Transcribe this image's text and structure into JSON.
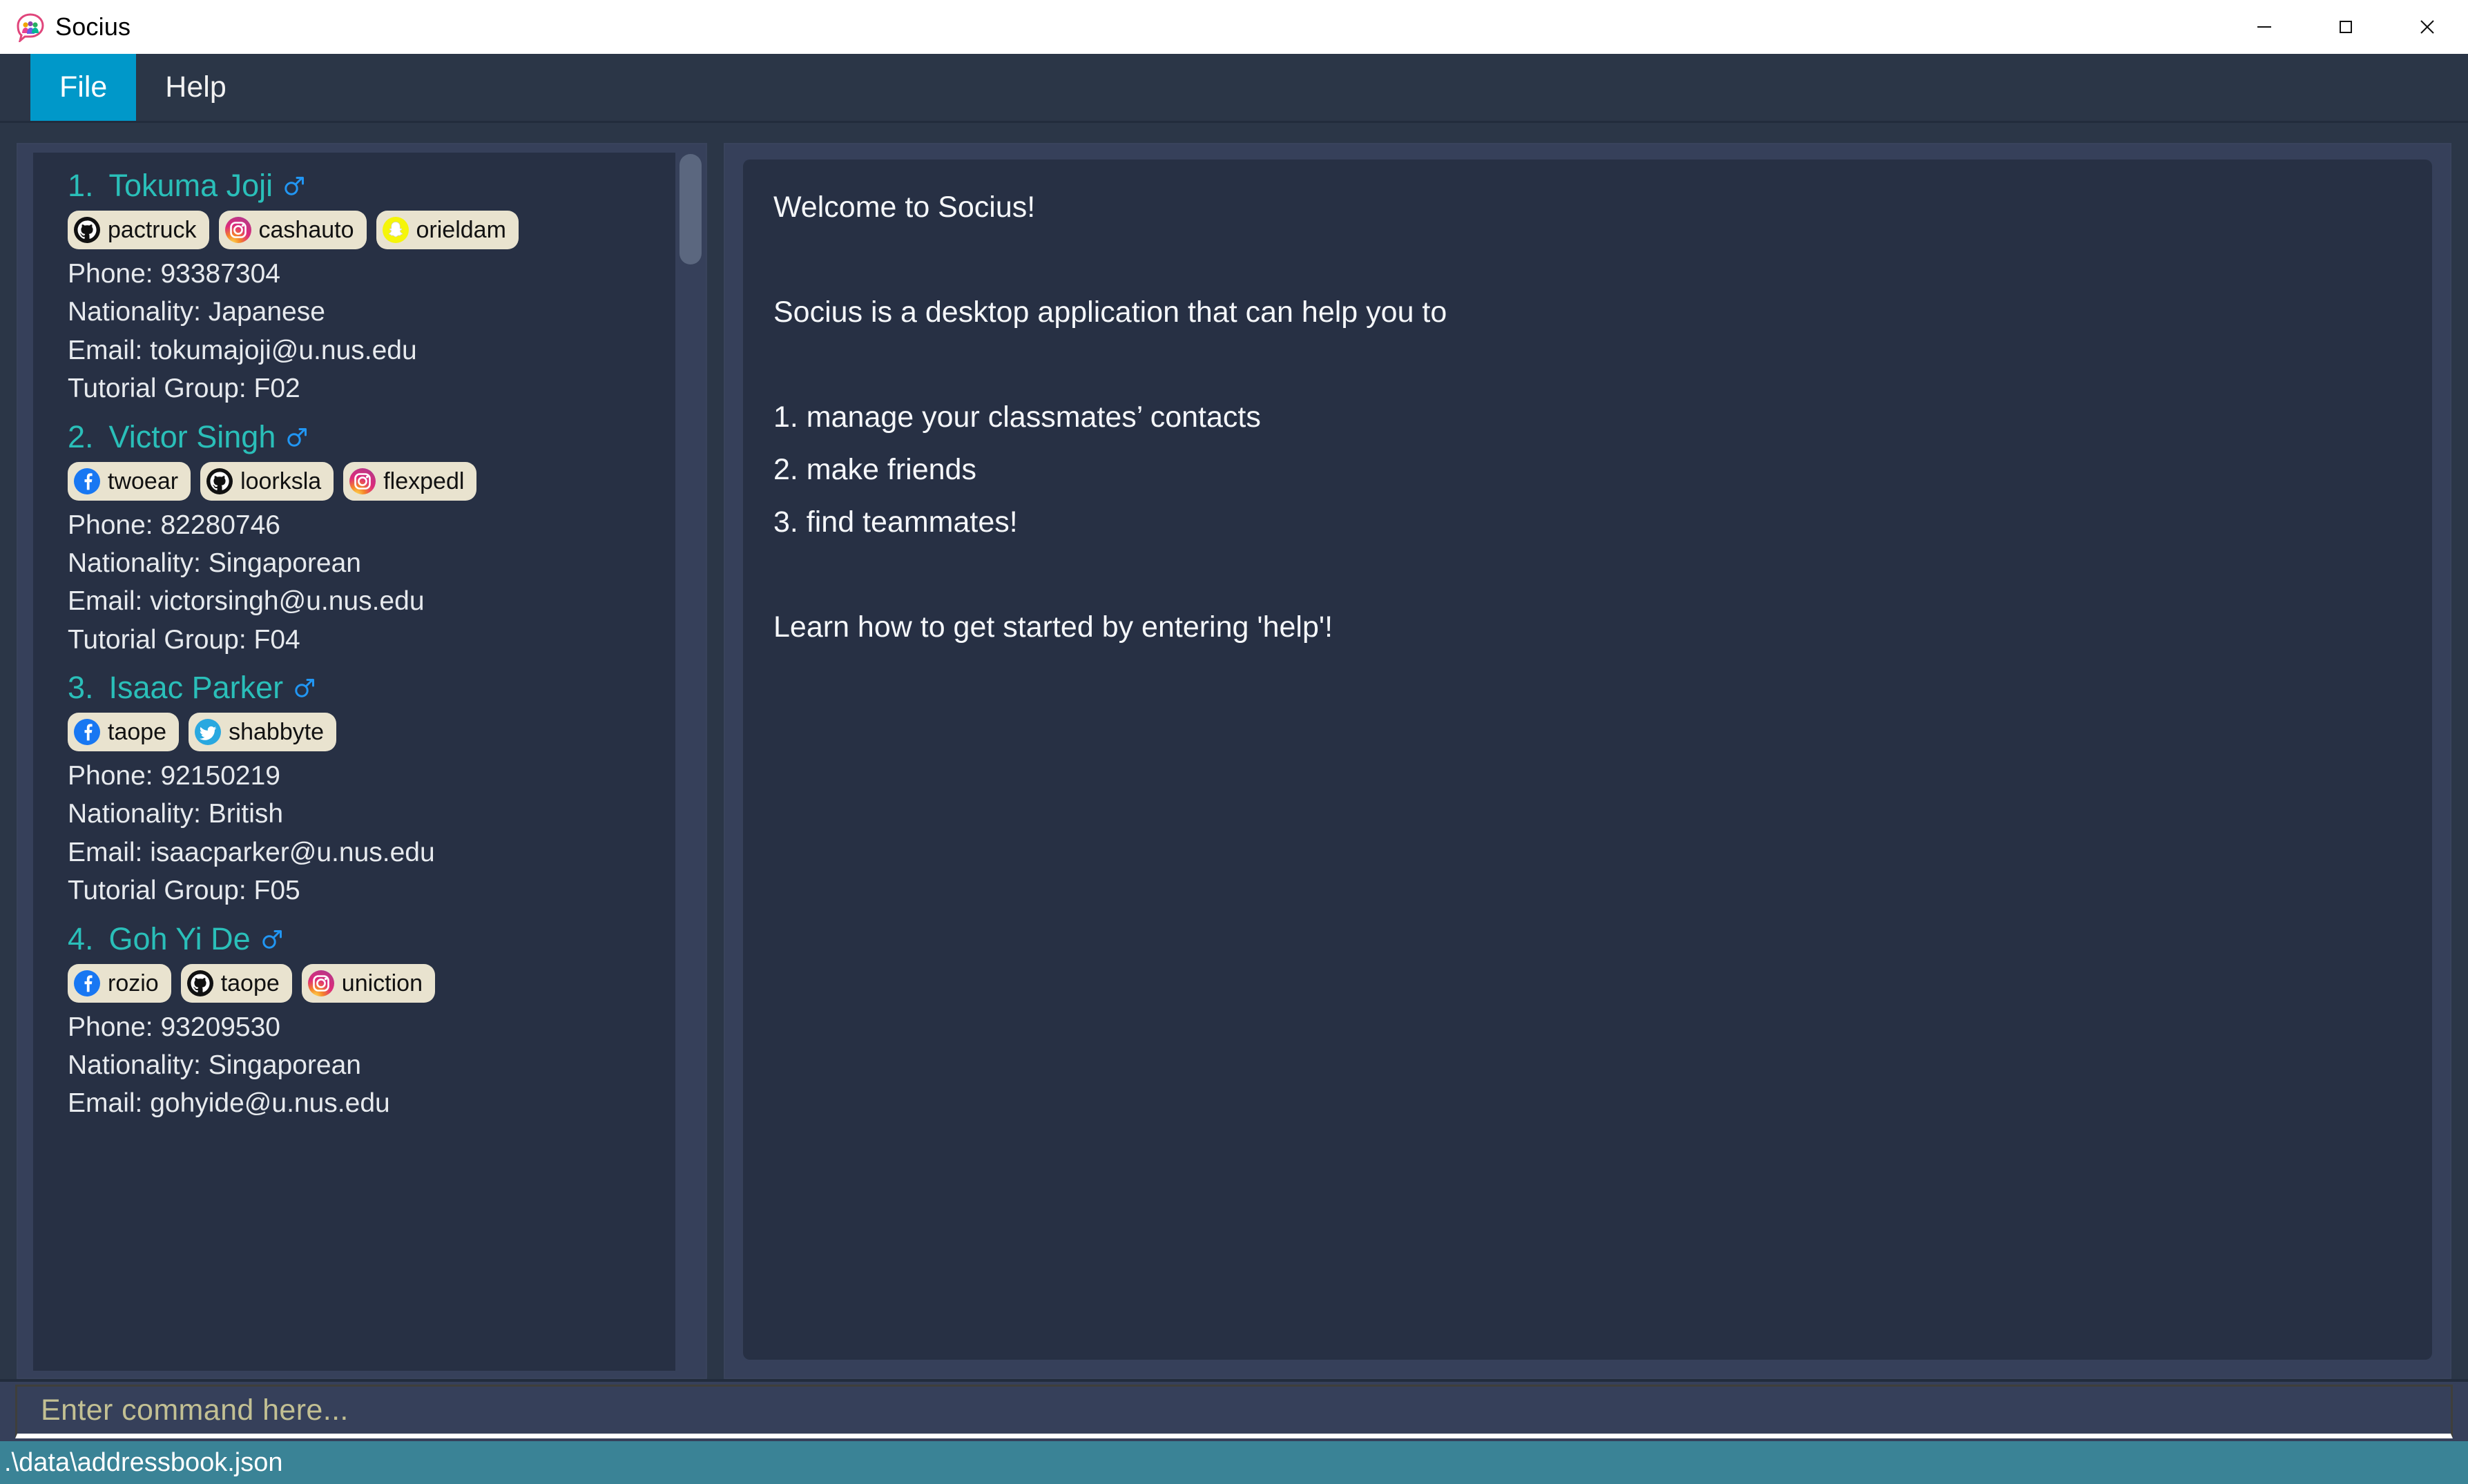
{
  "window": {
    "title": "Socius",
    "icon": "socius-app-icon",
    "controls": [
      {
        "name": "minimize-button",
        "glyph": "minimize-icon"
      },
      {
        "name": "maximize-button",
        "glyph": "maximize-icon"
      },
      {
        "name": "close-button",
        "glyph": "close-icon"
      }
    ]
  },
  "menubar": {
    "items": [
      {
        "label": "File",
        "active": true
      },
      {
        "label": "Help",
        "active": false
      }
    ]
  },
  "colors": {
    "accent_blue": "#0098c9",
    "window_bg": "#2b3647",
    "panel_bg": "#36405a",
    "content_bg": "#273044",
    "name_teal": "#2abfb9",
    "gender_blue": "#2196f3",
    "tag_bg": "#e9e3cf",
    "status_bar": "#3a8396",
    "placeholder": "#c3c093"
  },
  "person_list": {
    "scrollbar": {
      "name": "person-list-scrollbar",
      "thumb_position": "top"
    },
    "people": [
      {
        "index": "1.",
        "name": "Tokuma Joji",
        "gender": "male",
        "tags": [
          {
            "platform": "github",
            "handle": "pactruck"
          },
          {
            "platform": "instagram",
            "handle": "cashauto"
          },
          {
            "platform": "snapchat",
            "handle": "orieldam"
          }
        ],
        "phone": "Phone: 93387304",
        "nationality": "Nationality: Japanese",
        "email": "Email: tokumajoji@u.nus.edu",
        "tutorial_group": "Tutorial Group: F02"
      },
      {
        "index": "2.",
        "name": "Victor Singh",
        "gender": "male",
        "tags": [
          {
            "platform": "facebook",
            "handle": "twoear"
          },
          {
            "platform": "github",
            "handle": "loorksla"
          },
          {
            "platform": "instagram",
            "handle": "flexpedl"
          }
        ],
        "phone": "Phone: 82280746",
        "nationality": "Nationality: Singaporean",
        "email": "Email: victorsingh@u.nus.edu",
        "tutorial_group": "Tutorial Group: F04"
      },
      {
        "index": "3.",
        "name": "Isaac Parker",
        "gender": "male",
        "tags": [
          {
            "platform": "facebook",
            "handle": "taope"
          },
          {
            "platform": "twitter",
            "handle": "shabbyte"
          }
        ],
        "phone": "Phone: 92150219",
        "nationality": "Nationality: British",
        "email": "Email: isaacparker@u.nus.edu",
        "tutorial_group": "Tutorial Group: F05"
      },
      {
        "index": "4.",
        "name": "Goh Yi De",
        "gender": "male",
        "tags": [
          {
            "platform": "facebook",
            "handle": "rozio"
          },
          {
            "platform": "github",
            "handle": "taope"
          },
          {
            "platform": "instagram",
            "handle": "uniction"
          }
        ],
        "phone": "Phone: 93209530",
        "nationality": "Nationality: Singaporean",
        "email": "Email: gohyide@u.nus.edu",
        "tutorial_group": ""
      }
    ]
  },
  "result_display": {
    "lines": [
      "Welcome to Socius!",
      "",
      "Socius is a desktop application that can help you to",
      "",
      "1. manage your classmates’ contacts",
      "2. make friends",
      "3. find teammates!",
      "",
      "Learn how to get started by entering 'help'!"
    ]
  },
  "command_box": {
    "value": "",
    "placeholder": "Enter command here..."
  },
  "status_bar": {
    "save_location": ".\\data\\addressbook.json"
  }
}
